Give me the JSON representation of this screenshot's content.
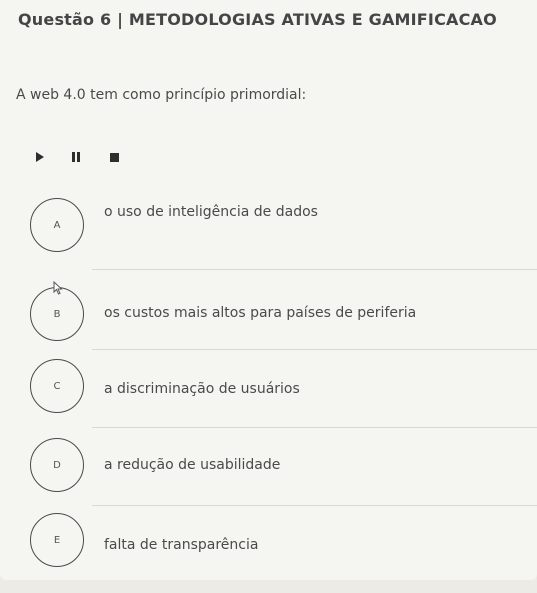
{
  "question": {
    "title": "Questão 6 | METODOLOGIAS ATIVAS E GAMIFICACAO",
    "prompt": "A web 4.0 tem como princípio primordial:"
  },
  "media_controls": {
    "icons": [
      "play-icon",
      "pause-icon",
      "stop-icon"
    ]
  },
  "options": [
    {
      "letter": "A",
      "text": "o uso de inteligência de dados"
    },
    {
      "letter": "B",
      "text": "os custos mais altos para países de periferia"
    },
    {
      "letter": "C",
      "text": "a discriminação de usuários"
    },
    {
      "letter": "D",
      "text": "a redução de usabilidade"
    },
    {
      "letter": "E",
      "text": "falta de transparência"
    }
  ]
}
